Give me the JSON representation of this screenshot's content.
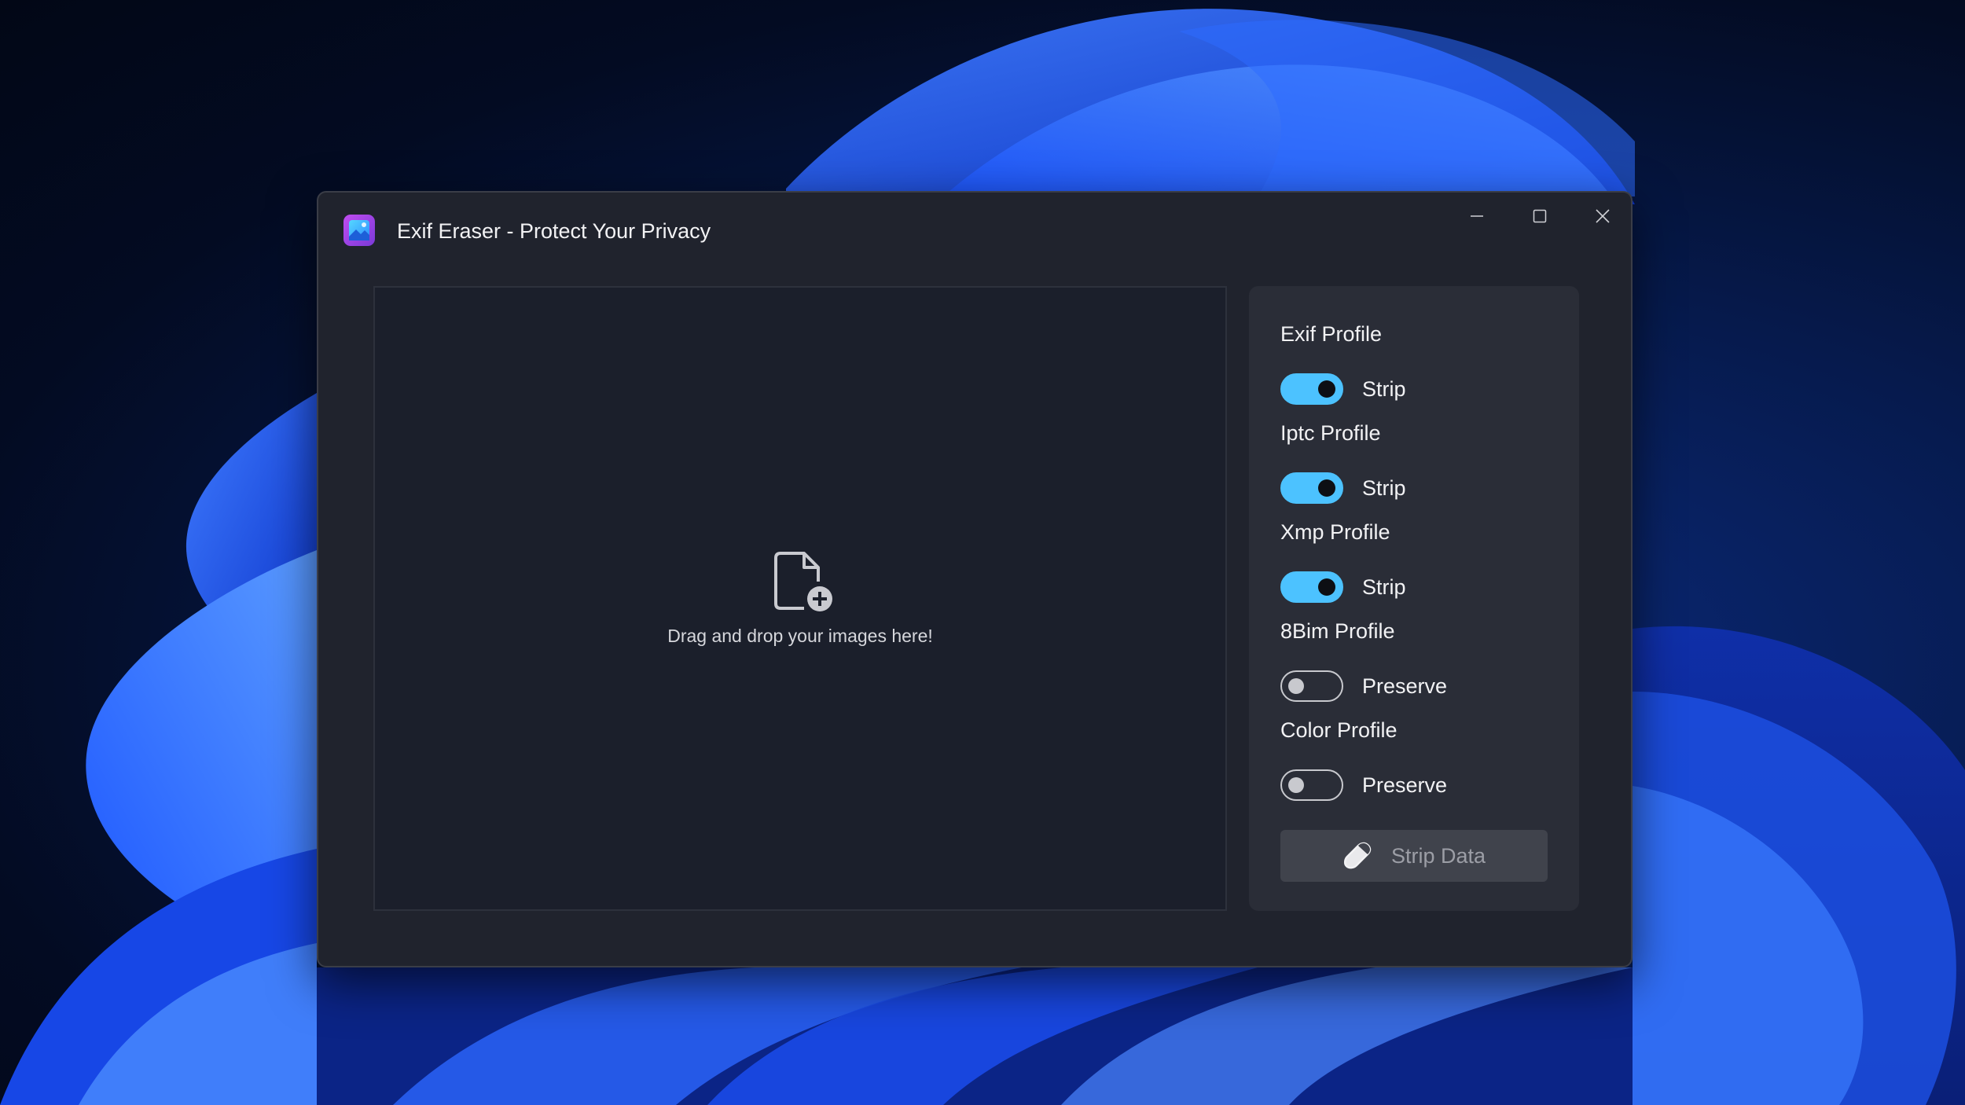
{
  "window": {
    "title": "Exif Eraser - Protect Your Privacy",
    "icon": "app-icon",
    "controls": [
      "minimize-icon",
      "maximize-icon",
      "close-icon"
    ]
  },
  "drop_zone": {
    "icon": "add-file-icon",
    "text": "Drag and drop your images here!"
  },
  "options": [
    {
      "heading": "Exif Profile",
      "toggle_label": "Strip",
      "on": true
    },
    {
      "heading": "Iptc Profile",
      "toggle_label": "Strip",
      "on": true
    },
    {
      "heading": "Xmp Profile",
      "toggle_label": "Strip",
      "on": true
    },
    {
      "heading": "8Bim Profile",
      "toggle_label": "Preserve",
      "on": false
    },
    {
      "heading": "Color Profile",
      "toggle_label": "Preserve",
      "on": false
    }
  ],
  "action": {
    "label": "Strip Data",
    "icon": "eraser-icon",
    "enabled": false
  },
  "colors": {
    "accent": "#4cc2ff",
    "window_bg": "#20232d",
    "panel_bg": "#2a2d37",
    "drop_bg": "#1b1f2b"
  }
}
